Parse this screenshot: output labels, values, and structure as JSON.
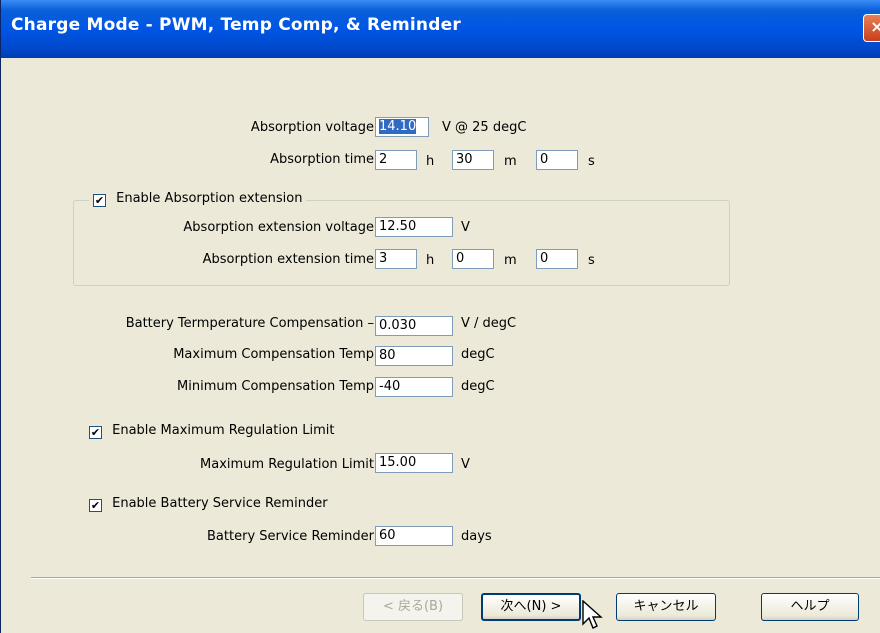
{
  "window": {
    "title": "Charge Mode - PWM, Temp Comp, & Reminder"
  },
  "absorption": {
    "voltage_label": "Absorption voltage",
    "voltage_value": "14.10",
    "voltage_unit": "V @ 25 degC",
    "time_label": "Absorption time",
    "hours": "2",
    "hours_unit": "h",
    "minutes": "30",
    "minutes_unit": "m",
    "seconds": "0",
    "seconds_unit": "s"
  },
  "extension": {
    "enable_label": "Enable Absorption extension",
    "enabled": true,
    "voltage_label": "Absorption extension voltage",
    "voltage_value": "12.50",
    "voltage_unit": "V",
    "time_label": "Absorption extension time",
    "hours": "3",
    "hours_unit": "h",
    "minutes": "0",
    "minutes_unit": "m",
    "seconds": "0",
    "seconds_unit": "s"
  },
  "temp_comp": {
    "comp_label": "Battery Termperature Compensation  –",
    "comp_value": "0.030",
    "comp_unit": "V / degC",
    "max_label": "Maximum Compensation Temp",
    "max_value": "80",
    "max_unit": "degC",
    "min_label": "Minimum Compensation Temp",
    "min_value": "-40",
    "min_unit": "degC"
  },
  "regulation": {
    "enable_label": "Enable Maximum Regulation Limit",
    "enabled": true,
    "limit_label": "Maximum Regulation Limit",
    "limit_value": "15.00",
    "limit_unit": "V"
  },
  "reminder": {
    "enable_label": "Enable Battery Service Reminder",
    "enabled": true,
    "label": "Battery Service Reminder",
    "value": "60",
    "unit": "days"
  },
  "buttons": {
    "back": "< 戻る(B)",
    "next": "次へ(N) >",
    "cancel": "キャンセル",
    "help": "ヘルプ"
  },
  "icons": {
    "close": "close-icon",
    "check": "checkmark-icon",
    "cursor": "mouse-pointer-icon"
  },
  "colors": {
    "titlebar": "#0055e5",
    "selection": "#316ac5",
    "close": "#c6401c"
  }
}
